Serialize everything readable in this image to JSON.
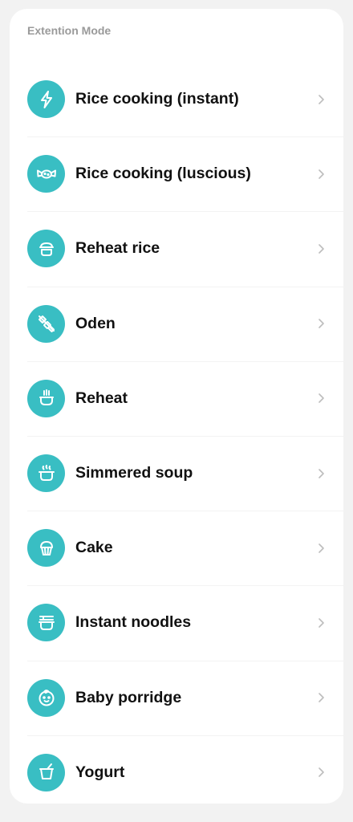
{
  "section": {
    "title": "Extention Mode"
  },
  "accent_color": "#39bec3",
  "items": [
    {
      "label": "Rice cooking (instant)",
      "icon": "lightning-icon"
    },
    {
      "label": "Rice cooking (luscious)",
      "icon": "candy-icon"
    },
    {
      "label": "Reheat rice",
      "icon": "rice-bowl-icon"
    },
    {
      "label": "Oden",
      "icon": "oden-skewer-icon"
    },
    {
      "label": "Reheat",
      "icon": "steaming-bowl-icon"
    },
    {
      "label": "Simmered soup",
      "icon": "soup-pot-icon"
    },
    {
      "label": "Cake",
      "icon": "cupcake-icon"
    },
    {
      "label": "Instant noodles",
      "icon": "noodle-cup-icon"
    },
    {
      "label": "Baby porridge",
      "icon": "baby-face-icon"
    },
    {
      "label": "Yogurt",
      "icon": "yogurt-cup-icon"
    }
  ]
}
